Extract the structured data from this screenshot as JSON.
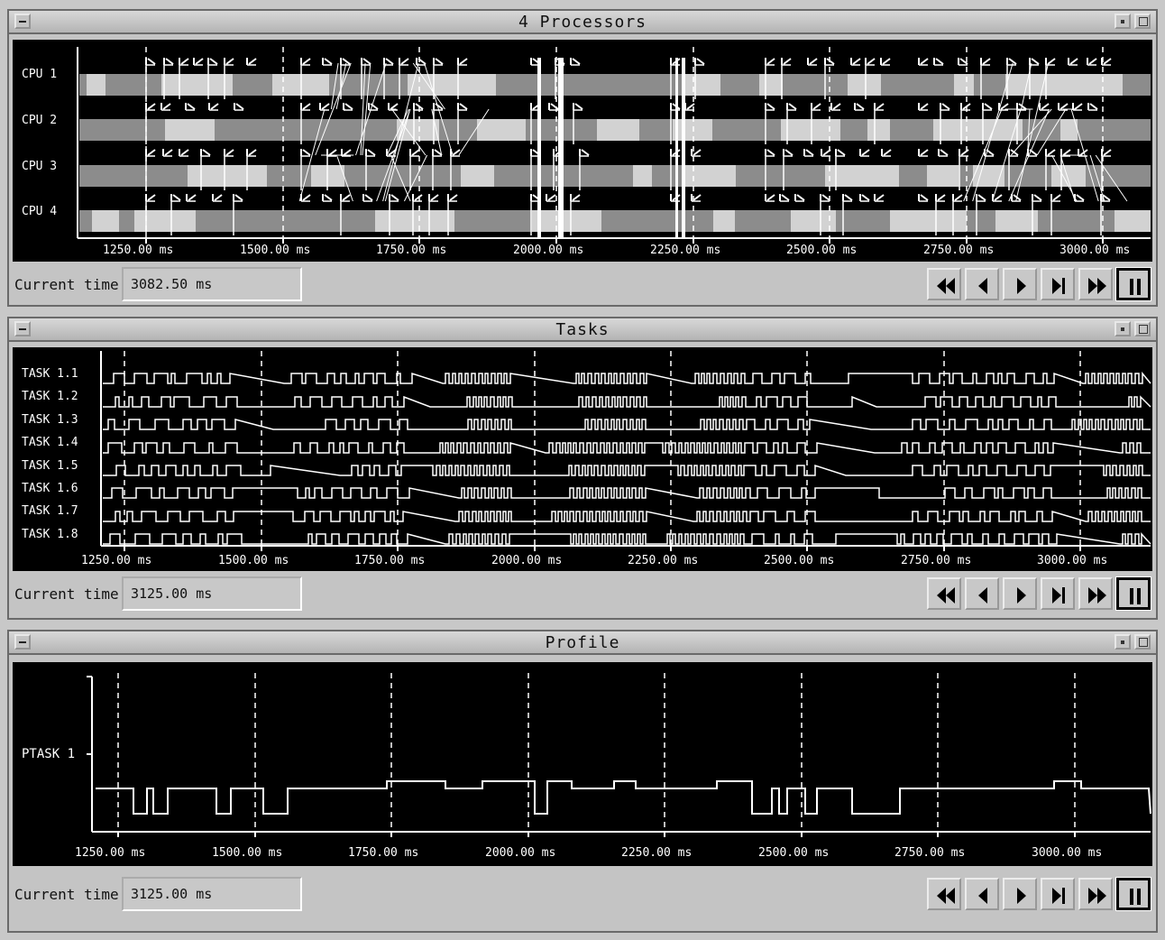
{
  "windows": [
    {
      "id": "processors",
      "title": "4 Processors",
      "rows": [
        "CPU 1",
        "CPU 2",
        "CPU 3",
        "CPU 4"
      ],
      "ticks": [
        "1250.00 ms",
        "1500.00 ms",
        "1750.00 ms",
        "2000.00 ms",
        "2250.00 ms",
        "2500.00 ms",
        "2750.00 ms",
        "3000.00 ms"
      ],
      "current_time_label": "Current time",
      "current_time_value": "3082.50 ms"
    },
    {
      "id": "tasks",
      "title": "Tasks",
      "rows": [
        "TASK 1.1",
        "TASK 1.2",
        "TASK 1.3",
        "TASK 1.4",
        "TASK 1.5",
        "TASK 1.6",
        "TASK 1.7",
        "TASK 1.8"
      ],
      "ticks": [
        "1250.00 ms",
        "1500.00 ms",
        "1750.00 ms",
        "2000.00 ms",
        "2250.00 ms",
        "2500.00 ms",
        "2750.00 ms",
        "3000.00 ms"
      ],
      "current_time_label": "Current time",
      "current_time_value": "3125.00 ms"
    },
    {
      "id": "profile",
      "title": "Profile",
      "rows": [
        "PTASK 1"
      ],
      "ticks": [
        "1250.00 ms",
        "1500.00 ms",
        "1750.00 ms",
        "2000.00 ms",
        "2250.00 ms",
        "2500.00 ms",
        "2750.00 ms",
        "3000.00 ms"
      ],
      "current_time_label": "Current time",
      "current_time_value": "3125.00 ms"
    }
  ],
  "playback_buttons": [
    "rewind-icon",
    "step-back-icon",
    "play-icon",
    "step-end-icon",
    "fast-forward-icon",
    "pause-icon"
  ],
  "colors": {
    "plot_bg": "#000000",
    "trace": "#ffffff",
    "lane_dark": "#8c8c8c",
    "lane_light": "#d2d2d2",
    "panel": "#c4c4c4"
  }
}
